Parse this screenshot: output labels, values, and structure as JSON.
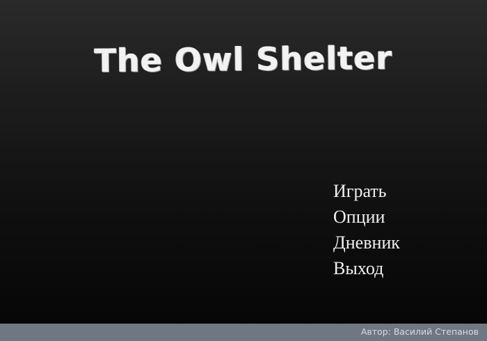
{
  "game": {
    "title": "The Owl Shelter"
  },
  "menu": {
    "items": [
      {
        "label": "Играть"
      },
      {
        "label": "Опции"
      },
      {
        "label": "Дневник"
      },
      {
        "label": "Выход"
      }
    ]
  },
  "footer": {
    "author": "Автор: Василий Степанов"
  },
  "colors": {
    "background_top": "#2a2a2a",
    "background_bottom": "#050505",
    "text": "#f0f0f0",
    "footer_bar": "#6f7783",
    "footer_text": "#d7dce3"
  }
}
